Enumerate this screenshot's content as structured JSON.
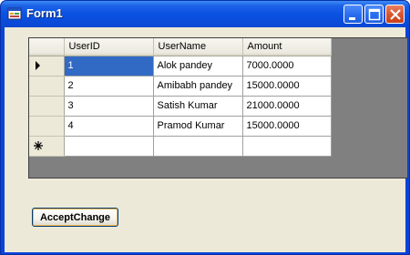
{
  "window": {
    "title": "Form1",
    "icon": "form-app-icon",
    "controls": [
      "minimize-icon",
      "maximize-icon",
      "close-icon"
    ]
  },
  "grid": {
    "columns": [
      "UserID",
      "UserName",
      "Amount"
    ],
    "rows": [
      {
        "marker": "current-row-arrow",
        "cells": [
          "1",
          "Alok pandey",
          "7000.0000"
        ]
      },
      {
        "marker": "",
        "cells": [
          "2",
          "Amibabh pandey",
          "15000.0000"
        ]
      },
      {
        "marker": "",
        "cells": [
          "3",
          "Satish Kumar",
          "21000.0000"
        ]
      },
      {
        "marker": "",
        "cells": [
          "4",
          "Pramod Kumar",
          "15000.0000"
        ]
      }
    ],
    "new_row_marker": "new-row-asterisk",
    "selected_cell": {
      "row": 0,
      "column": "UserID"
    }
  },
  "buttons": {
    "accept_change": "AcceptChange"
  }
}
